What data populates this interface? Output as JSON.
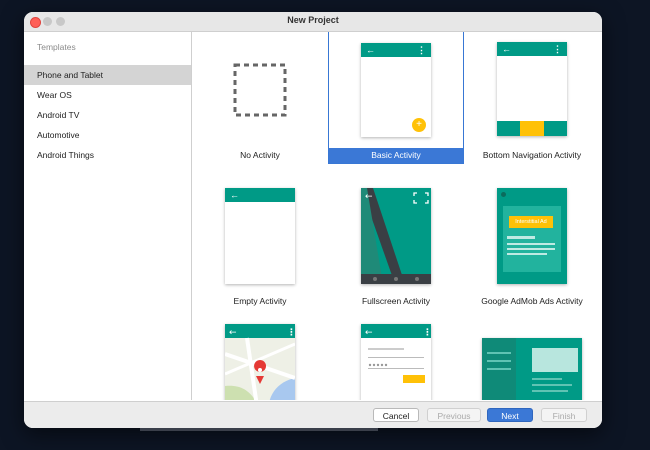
{
  "window": {
    "title": "New Project"
  },
  "sidebar": {
    "heading": "Templates",
    "items": [
      {
        "label": "Phone and Tablet",
        "selected": true
      },
      {
        "label": "Wear OS"
      },
      {
        "label": "Android TV"
      },
      {
        "label": "Automotive"
      },
      {
        "label": "Android Things"
      }
    ]
  },
  "templates": [
    {
      "label": "No Activity",
      "icon": "dashed-square-icon"
    },
    {
      "label": "Basic Activity",
      "icon": "basic-activity-preview",
      "selected": true,
      "fab_glyph": "+"
    },
    {
      "label": "Bottom Navigation Activity",
      "icon": "bottom-navigation-preview"
    },
    {
      "label": "Empty Activity",
      "icon": "empty-activity-preview"
    },
    {
      "label": "Fullscreen Activity",
      "icon": "fullscreen-activity-preview"
    },
    {
      "label": "Google AdMob Ads Activity",
      "icon": "admob-activity-preview",
      "ad_text": "Interstitial Ad"
    },
    {
      "label": "",
      "icon": "maps-activity-preview"
    },
    {
      "label": "",
      "icon": "login-activity-preview"
    },
    {
      "label": "",
      "icon": "master-detail-preview"
    }
  ],
  "appbar": {
    "back_glyph": "←",
    "menu_glyph": "⋮"
  },
  "footer": {
    "cancel": "Cancel",
    "previous": "Previous",
    "next": "Next",
    "finish": "Finish"
  },
  "colors": {
    "teal": "#009a86",
    "accent_yellow": "#ffc107",
    "selection_blue": "#3b78d6"
  }
}
